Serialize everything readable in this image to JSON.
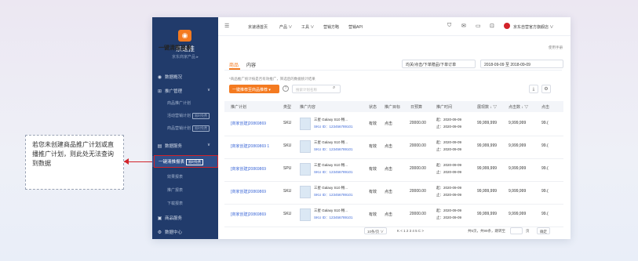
{
  "callout": {
    "text": "若您未创建商品推广计划或直播推广计划，则此处无法查询到数据"
  },
  "sidebar": {
    "brand": "京速推",
    "brand_sub": "京东商家产品 ▸",
    "items": [
      {
        "icon": "◉",
        "label": "数据概况"
      },
      {
        "icon": "⊞",
        "label": "推广管理",
        "caret": "∨"
      },
      {
        "icon": "▤",
        "label": "数据服务",
        "caret": "∨"
      },
      {
        "icon": "▣",
        "label": "商品服务"
      },
      {
        "icon": "⚙",
        "label": "数据中心"
      }
    ],
    "subitems": [
      {
        "label": "商品推广计划"
      },
      {
        "label": "活动营销计划",
        "badge": "限时免费"
      },
      {
        "label": "商品营销计划",
        "badge": "限时免费"
      },
      {
        "label": "效果报表"
      },
      {
        "label": "推广报表"
      },
      {
        "label": "下载报表"
      }
    ],
    "active": {
      "label": "一键清推报表",
      "badge": "限时免费"
    }
  },
  "topbar": {
    "nav": [
      "京速通首页",
      "产品 ∨",
      "工具 ∨",
      "营销方略",
      "营销API"
    ],
    "user": "京东自营官方旗舰店 ∨"
  },
  "page": {
    "title": "一键清推报表",
    "right": "使用手册"
  },
  "tabs": [
    "商品",
    "内容"
  ],
  "filters": {
    "select": "均关/点击/下单赠品/下单订单",
    "date": "2018-09-09 至 2018-09-09"
  },
  "note": "*商品推广统计按是否有效推广，筛选后的数据统计结果",
  "toolbar": {
    "add_label": "一键推荐至商品推荐 ▾",
    "search_placeholder": "搜索计划名称"
  },
  "table": {
    "headers": [
      "推广计划",
      "类型",
      "推广内容",
      "状态",
      "推广目标",
      "日预算",
      "推广时间",
      "展现数 ↓ ▽",
      "点击数 ↓ ▽",
      "点击"
    ],
    "rows": [
      {
        "plan": "[商家创建]20869869",
        "type": "SKU",
        "title": "三星 Galaxy S10 畅...",
        "sku": "SKU ID：123456789101",
        "status": "有效",
        "goal": "点击",
        "budget": "20000.00",
        "t1": "起：2020-09-09",
        "t2": "止：2020-09-09",
        "show": "99,999,999",
        "click": "9,999,999",
        "more": "99.("
      },
      {
        "plan": "[商家创建]20869869\n1",
        "type": "SKU",
        "title": "三星 Galaxy S10 畅...",
        "sku": "SKU ID：123456789101",
        "status": "有效",
        "goal": "点击",
        "budget": "20000.00",
        "t1": "起：2020-09-09",
        "t2": "止：2020-09-09",
        "show": "99,999,999",
        "click": "9,999,999",
        "more": "99.("
      },
      {
        "plan": "[商家创建]20869869",
        "type": "SPU",
        "title": "三星 Galaxy S10 畅...",
        "sku": "SKU ID：123456789101",
        "status": "有效",
        "goal": "点击",
        "budget": "20000.00",
        "t1": "起：2020-09-09",
        "t2": "止：2020-09-09",
        "show": "99,999,999",
        "click": "9,999,999",
        "more": "99.("
      },
      {
        "plan": "[商家创建]20869869",
        "type": "SKU",
        "title": "三星 Galaxy S10 畅...",
        "sku": "SKU ID：123456789101",
        "status": "有效",
        "goal": "点击",
        "budget": "20000.00",
        "t1": "起：2020-09-09",
        "t2": "止：2020-09-09",
        "show": "99,999,999",
        "click": "9,999,999",
        "more": "99.("
      },
      {
        "plan": "[商家创建]20869869",
        "type": "SKU",
        "title": "三星 Galaxy S10 畅...",
        "sku": "SKU ID：123456789101",
        "status": "有效",
        "goal": "点击",
        "budget": "20000.00",
        "t1": "起：2020-09-09",
        "t2": "止：2020-09-09",
        "show": "99,999,999",
        "click": "9,999,999",
        "more": "99.("
      }
    ]
  },
  "pager": {
    "size": "10条/页 ∨",
    "pages": "K  <  1  2  3  4  5  C  >",
    "total": "共5页，共99条，跳转至",
    "go": "页",
    "confirm": "确定"
  },
  "colors": {
    "sidebar": "#213b6b",
    "accent": "#f47a20",
    "highlight": "#d2232a",
    "link": "#3f6ad8"
  }
}
